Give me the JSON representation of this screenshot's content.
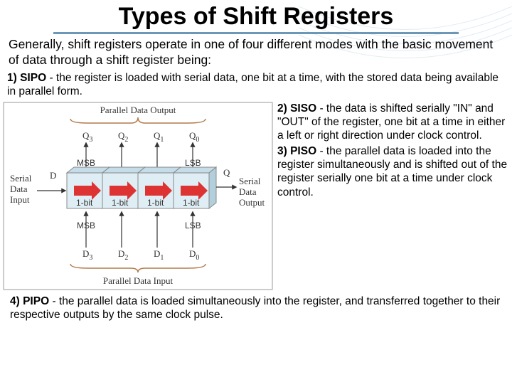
{
  "title": "Types of Shift Registers",
  "intro": "Generally, shift registers operate in one of four different modes with the basic movement of data through a shift register being:",
  "sipo": {
    "head": "1) SIPO",
    "body": " - the register is loaded with serial data, one bit at a time, with the stored data being available in parallel form."
  },
  "siso": {
    "head": "2) SISO",
    "body": " - the data is shifted serially \"IN\" and \"OUT\" of the register, one bit at a time in either a left or right direction under clock control."
  },
  "piso": {
    "head": "3) PISO",
    "body": " - the parallel data is loaded into the register simultaneously and is shifted out of the register serially one bit at a time under clock control."
  },
  "pipo": {
    "head": "4) PIPO",
    "body": " - the parallel data is loaded simultaneously into the register, and transferred together to their respective outputs by the same clock pulse."
  },
  "diagram": {
    "top_label": "Parallel Data Output",
    "bottom_label": "Parallel Data Input",
    "left1": "Serial",
    "left2": "Data",
    "left3": "Input",
    "right1": "Serial",
    "right2": "Data",
    "right3": "Output",
    "D": "D",
    "Q": "Q",
    "msb": "MSB",
    "lsb": "LSB",
    "q3": "Q",
    "q2": "Q",
    "q1": "Q",
    "q0": "Q",
    "d3": "D",
    "d2": "D",
    "d1": "D",
    "d0": "D",
    "s3": "3",
    "s2": "2",
    "s1": "1",
    "s0": "0",
    "bit": "1-bit"
  }
}
